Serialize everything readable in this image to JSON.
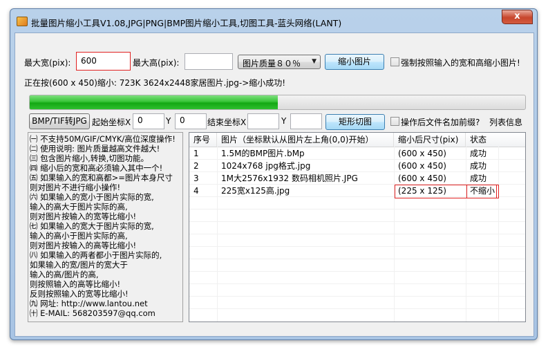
{
  "window": {
    "title": "批量图片缩小工具V1.08,JPG|PNG|BMP图片缩小工具,切图工具-蓝头网络(LANT)",
    "close_label": "x"
  },
  "controls": {
    "max_width_label": "最大宽(pix):",
    "max_width_value": "600",
    "max_height_label": "最大高(pix):",
    "max_height_value": "",
    "quality_select": "图片质量８０％",
    "shrink_button": "缩小图片",
    "force_checkbox_label": "强制按照输入的宽和高缩小图片!",
    "status_text": "正在按(600 x 450)缩小: 723K 3624x2448家居图片.jpg->缩小成功!",
    "progress_fraction": 0.5,
    "bmp_tif_button": "BMP/TIF转JPG",
    "start_x_label": "起始坐标X",
    "start_x_value": "0",
    "start_y_label": "Y",
    "start_y_value": "0",
    "end_x_label": "结束坐标X",
    "end_x_value": "",
    "end_y_label": "Y",
    "end_y_value": "",
    "crop_button": "矩形切图",
    "prefix_checkbox_label": "操作后文件名加前缀?",
    "list_info_link": "列表信息"
  },
  "info": {
    "lines": [
      "㈠ 不支持50M/GIF/CMYK/高位深度操作!",
      "㈡ 使用说明: 图片质量越高文件越大!",
      "㈢ 包含图片缩小,转换,切图功能。",
      "㈣ 缩小后的宽和高必须输入其中一个!",
      "㈤ 如果输入的宽和高都>=图片本身尺寸",
      "     则对图片不进行缩小操作!",
      "㈥ 如果输入的宽小于图片实际的宽,",
      "     输入的高大于图片实际的高,",
      "     则对图片按输入的宽等比缩小!",
      "㈦ 如果输入的宽大于图片实际的宽,",
      "     输入的高小于图片实际的高,",
      "     则对图片按输入的高等比缩小!",
      "㈧ 如果输入的两者都小于图片实际的,",
      "     如果输入的宽/图片的宽大于",
      "     输入的高/图片的高,",
      "     则按照输入的高等比缩小!",
      "     反则按照输入的宽等比缩小!",
      "㈨ 网址: http://www.lantou.net",
      "㈩ E-MAIL: 568203597@qq.com"
    ]
  },
  "table": {
    "headers": [
      "序号",
      "图片（坐标默认从图片左上角(0,0)开始）",
      "缩小后尺寸(pix)",
      "状态"
    ],
    "rows": [
      [
        "1",
        "1.5M的BMP图片.bMp",
        "(600 x 450)",
        "成功"
      ],
      [
        "2",
        "1024x768 jpg格式.jpg",
        "(600 x 450)",
        "成功"
      ],
      [
        "3",
        "1M大2576x1932 数码相机照片.JPG",
        "(600 x 450)",
        "成功"
      ],
      [
        "4",
        "225宽x125高.jpg",
        "(225 x 125)",
        "不缩小"
      ]
    ]
  },
  "colors": {
    "progress_fill": "#22b522",
    "highlight_border": "#e02020"
  }
}
